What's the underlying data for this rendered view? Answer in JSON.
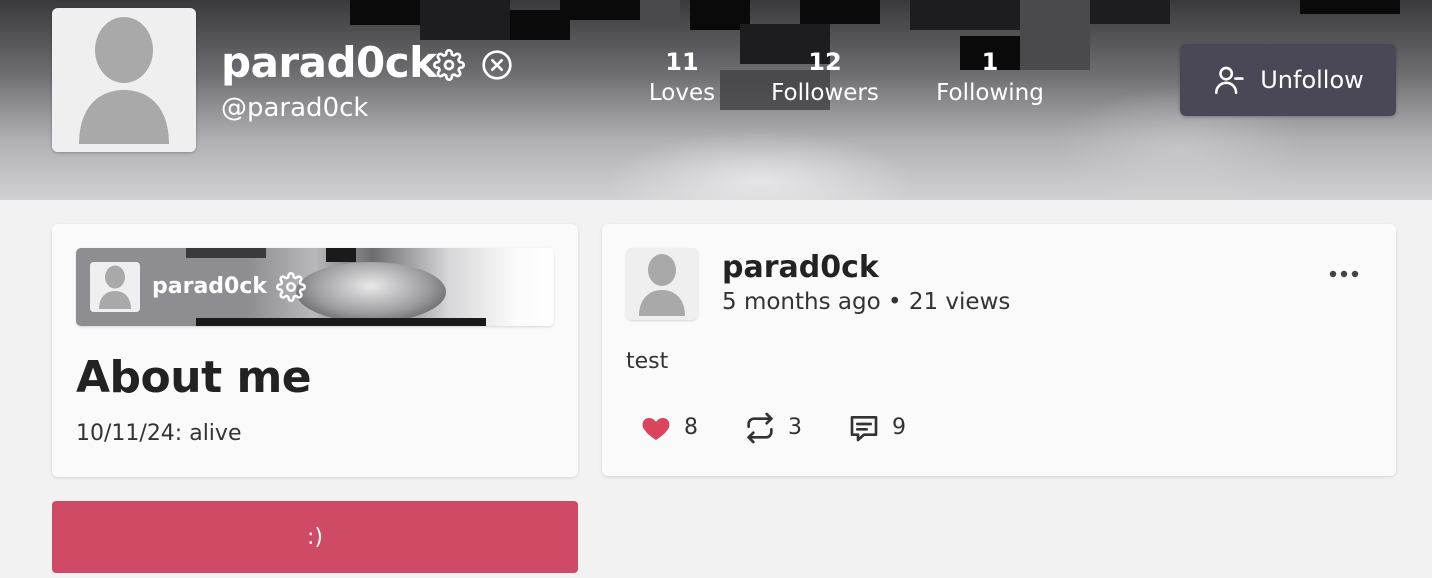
{
  "profile": {
    "name": "parad0ck",
    "handle": "@parad0ck"
  },
  "stats": [
    {
      "value": "11",
      "label": "Loves"
    },
    {
      "value": "12",
      "label": "Followers"
    },
    {
      "value": "1",
      "label": "Following"
    }
  ],
  "unfollow_label": "Unfollow",
  "about": {
    "mini_name": "parad0ck",
    "title": "About me",
    "body": "10/11/24: alive"
  },
  "smile_button_label": ":)",
  "post": {
    "author": "parad0ck",
    "meta": "5 months ago • 21 views",
    "text": "test",
    "likes": "8",
    "reposts": "3",
    "comments": "9"
  },
  "colors": {
    "unfollow_bg": "#4a4756",
    "smile_button_bg": "#cf4a64",
    "heart": "#d9445f"
  },
  "icons": {
    "settings": "gear-icon",
    "block": "circle-x-icon",
    "unfollow": "user-minus-icon",
    "like": "heart-icon",
    "repost": "repost-icon",
    "comment": "comment-icon",
    "more": "more-horizontal-icon"
  }
}
